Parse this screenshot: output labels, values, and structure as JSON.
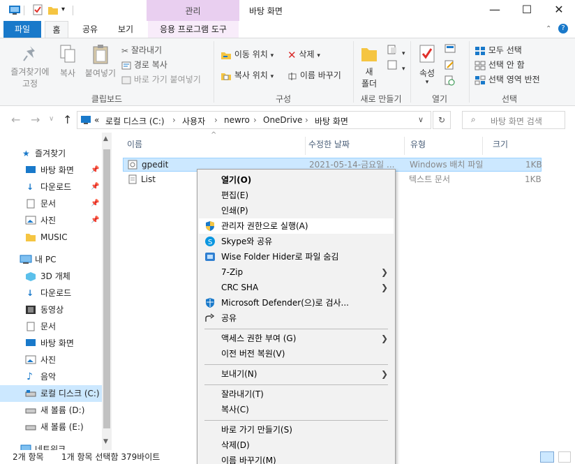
{
  "titlebar": {
    "context_tab": "관리",
    "title": "바탕 화면",
    "minimize": "—",
    "maximize": "☐",
    "close": "✕"
  },
  "tabs": [
    "파일",
    "홈",
    "공유",
    "보기",
    "응용 프로그램 도구"
  ],
  "ribbon": {
    "clipboard": {
      "pin": "즐겨찾기에\n고정",
      "pin_l1": "즐겨찾기에",
      "pin_l2": "고정",
      "copy": "복사",
      "paste": "붙여넣기",
      "cut": "잘라내기",
      "copy_path": "경로 복사",
      "paste_shortcut": "바로 가기 붙여넣기",
      "label": "클립보드"
    },
    "organize": {
      "move_to": "이동 위치",
      "copy_to": "복사 위치",
      "delete": "삭제",
      "rename": "이름 바꾸기",
      "label": "구성"
    },
    "new": {
      "new_folder_l1": "새",
      "new_folder_l2": "폴더",
      "label": "새로 만들기"
    },
    "open": {
      "properties": "속성",
      "label": "열기"
    },
    "select": {
      "select_all": "모두 선택",
      "select_none": "선택 안 함",
      "invert": "선택 영역 반전",
      "label": "선택"
    }
  },
  "address": {
    "prefix": "«",
    "crumbs": [
      "로컬 디스크 (C:)",
      "사용자",
      "newro",
      "OneDrive",
      "바탕 화면"
    ],
    "search_placeholder": "바탕 화면 검색"
  },
  "nav": {
    "items": [
      {
        "label": "즐겨찾기",
        "icon": "star-icon"
      },
      {
        "label": "바탕 화면",
        "icon": "desktop-icon"
      },
      {
        "label": "다운로드",
        "icon": "download-icon"
      },
      {
        "label": "문서",
        "icon": "document-icon"
      },
      {
        "label": "사진",
        "icon": "picture-icon"
      },
      {
        "label": "MUSIC",
        "icon": "folder-icon"
      },
      {
        "label": "내 PC",
        "icon": "pc-icon"
      },
      {
        "label": "3D 개체",
        "icon": "3d-icon"
      },
      {
        "label": "다운로드",
        "icon": "download-icon"
      },
      {
        "label": "동영상",
        "icon": "video-icon"
      },
      {
        "label": "문서",
        "icon": "document-icon"
      },
      {
        "label": "바탕 화면",
        "icon": "desktop-icon"
      },
      {
        "label": "사진",
        "icon": "picture-icon"
      },
      {
        "label": "음악",
        "icon": "music-icon"
      },
      {
        "label": "로컬 디스크 (C:)",
        "icon": "drive-icon"
      },
      {
        "label": "새 볼륨 (D:)",
        "icon": "drive-icon"
      },
      {
        "label": "새 볼륨 (E:)",
        "icon": "drive-icon"
      },
      {
        "label": "네트워크",
        "icon": "network-icon"
      }
    ]
  },
  "columns": [
    "이름",
    "수정한 날짜",
    "유형",
    "크기"
  ],
  "files": [
    {
      "name": "gpedit",
      "date": "2021-05-14-금요일 ...",
      "type": "Windows 배치 파일",
      "size": "1KB"
    },
    {
      "name": "List",
      "date": "",
      "type": "텍스트 문서",
      "size": "1KB"
    }
  ],
  "context_menu": {
    "items": [
      "열기(O)",
      "편집(E)",
      "인쇄(P)",
      "관리자 권한으로 실행(A)",
      "Skype와 공유",
      "Wise Folder Hider로 파일 숨김",
      "7-Zip",
      "CRC SHA",
      "Microsoft Defender(으)로 검사...",
      "공유",
      "액세스 권한 부여 (G)",
      "이전 버전 복원(V)",
      "보내기(N)",
      "잘라내기(T)",
      "복사(C)",
      "바로 가기 만들기(S)",
      "삭제(D)",
      "이름 바꾸기(M)"
    ]
  },
  "status": {
    "count": "2개 항목",
    "selection": "1개 항목 선택함 379바이트"
  },
  "colors": {
    "accent": "#1979ca",
    "selection": "#cce8ff",
    "context_tab": "#e9cff0"
  }
}
